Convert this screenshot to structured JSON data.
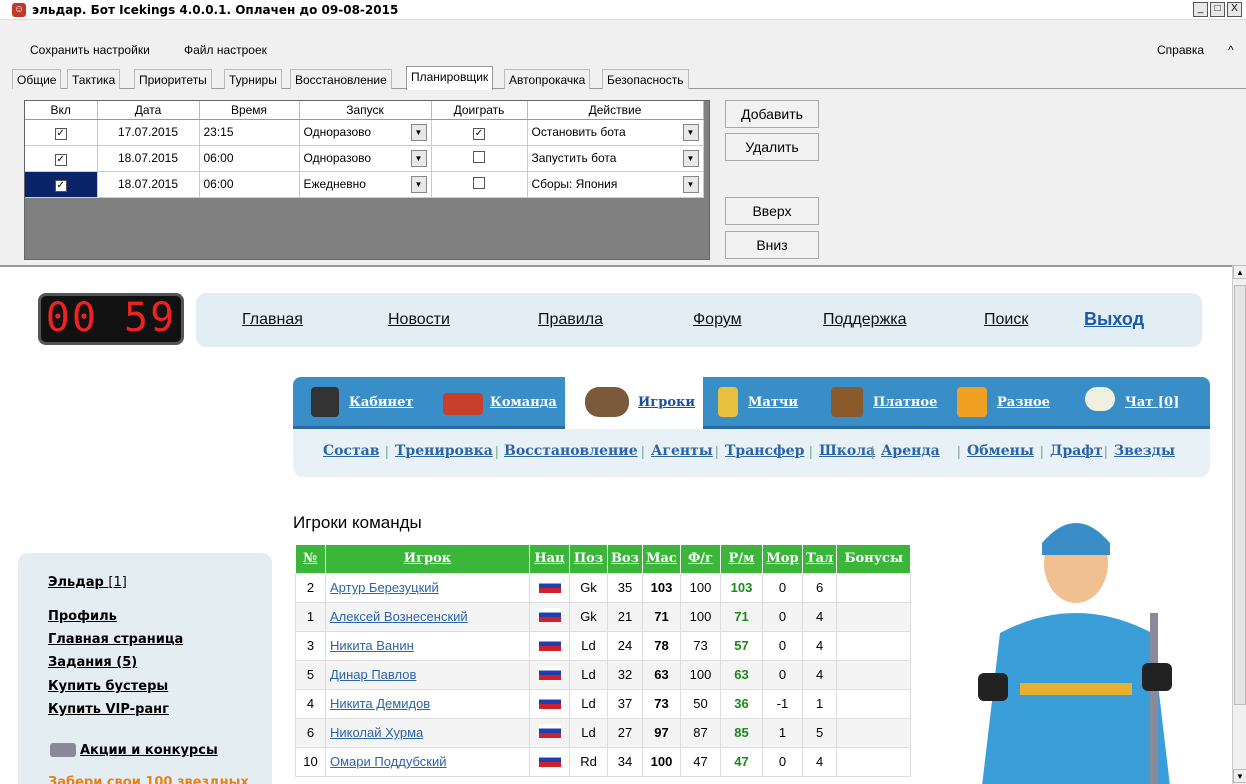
{
  "window": {
    "title": "эльдар. Бот Icekings 4.0.0.1. Оплачен до 09-08-2015",
    "min": "_",
    "max": "□",
    "close": "X"
  },
  "menu": {
    "save": "Сохранить настройки",
    "file": "Файл настроек",
    "help": "Справка",
    "collapse": "^"
  },
  "tabs": [
    "Общие",
    "Тактика",
    "Приоритеты",
    "Турниры",
    "Восстановление",
    "Планировщик",
    "Автопрокачка",
    "Безопасность"
  ],
  "active_tab": "Планировщик",
  "scheduler": {
    "headers": [
      "Вкл",
      "Дата",
      "Время",
      "Запуск",
      "Доиграть",
      "Действие"
    ],
    "rows": [
      {
        "date": "17.07.2015",
        "time": "23:15",
        "launch": "Одноразово",
        "action": "Остановить бота"
      },
      {
        "date": "18.07.2015",
        "time": "06:00",
        "launch": "Одноразово",
        "action": "Запустить бота"
      },
      {
        "date": "18.07.2015",
        "time": "06:00",
        "launch": "Ежедневно",
        "action": "Сборы: Япония"
      }
    ]
  },
  "buttons": {
    "add": "Добавить",
    "delete": "Удалить",
    "up": "Вверх",
    "down": "Вниз"
  },
  "timer": "00 59",
  "topnav": {
    "home": "Главная",
    "news": "Новости",
    "rules": "Правила",
    "forum": "Форум",
    "support": "Поддержка",
    "search": "Поиск",
    "exit": "Выход"
  },
  "gamenav": {
    "cabinet": "Кабинет",
    "team": "Команда",
    "players": "Игроки",
    "matches": "Матчи",
    "paid": "Платное",
    "misc": "Разное",
    "chat": "Чат [0]"
  },
  "subnav": [
    "Состав",
    "Тренировка",
    "Восстановление",
    "Агенты",
    "Трансфер",
    "Школа",
    "Аренда",
    "Обмены",
    "Драфт",
    "Звезды"
  ],
  "heading": "Игроки команды",
  "sidebar": {
    "user": "Эльдар",
    "user_level": "[1]",
    "profile": "Профиль",
    "main": "Главная страница",
    "tasks": "Задания",
    "tasks_count": "(5)",
    "boosters": "Купить бустеры",
    "vip": "Купить VIP-ранг",
    "promo": "Акции и конкурсы",
    "promo2": "Забери свои 100 звездных"
  },
  "players_table": {
    "headers": [
      "№",
      "Игрок",
      "Нац",
      "Поз",
      "Воз",
      "Мас",
      "Ф/г",
      "Р/м",
      "Мор",
      "Тал",
      "Бонусы"
    ],
    "rows": [
      {
        "n": "2",
        "name": "Артур Березуцкий",
        "pos": "Gk",
        "age": "35",
        "mas": "103",
        "fg": "100",
        "rm": "103",
        "mor": "0",
        "tal": "6"
      },
      {
        "n": "1",
        "name": "Алексей Вознесенский",
        "pos": "Gk",
        "age": "21",
        "mas": "71",
        "fg": "100",
        "rm": "71",
        "mor": "0",
        "tal": "4"
      },
      {
        "n": "3",
        "name": "Никита Ванин",
        "pos": "Ld",
        "age": "24",
        "mas": "78",
        "fg": "73",
        "rm": "57",
        "mor": "0",
        "tal": "4"
      },
      {
        "n": "5",
        "name": "Динар Павлов",
        "pos": "Ld",
        "age": "32",
        "mas": "63",
        "fg": "100",
        "rm": "63",
        "mor": "0",
        "tal": "4"
      },
      {
        "n": "4",
        "name": "Никита Демидов",
        "pos": "Ld",
        "age": "37",
        "mas": "73",
        "fg": "50",
        "rm": "36",
        "mor": "-1",
        "tal": "1"
      },
      {
        "n": "6",
        "name": "Николай Хурма",
        "pos": "Ld",
        "age": "27",
        "mas": "97",
        "fg": "87",
        "rm": "85",
        "mor": "1",
        "tal": "5"
      },
      {
        "n": "10",
        "name": "Омари Поддубский",
        "pos": "Rd",
        "age": "34",
        "mas": "100",
        "fg": "47",
        "rm": "47",
        "mor": "0",
        "tal": "4"
      }
    ]
  },
  "colors": {
    "accent": "#3a8ec8",
    "table_header": "#3bb63b",
    "link": "#2b64a8"
  }
}
